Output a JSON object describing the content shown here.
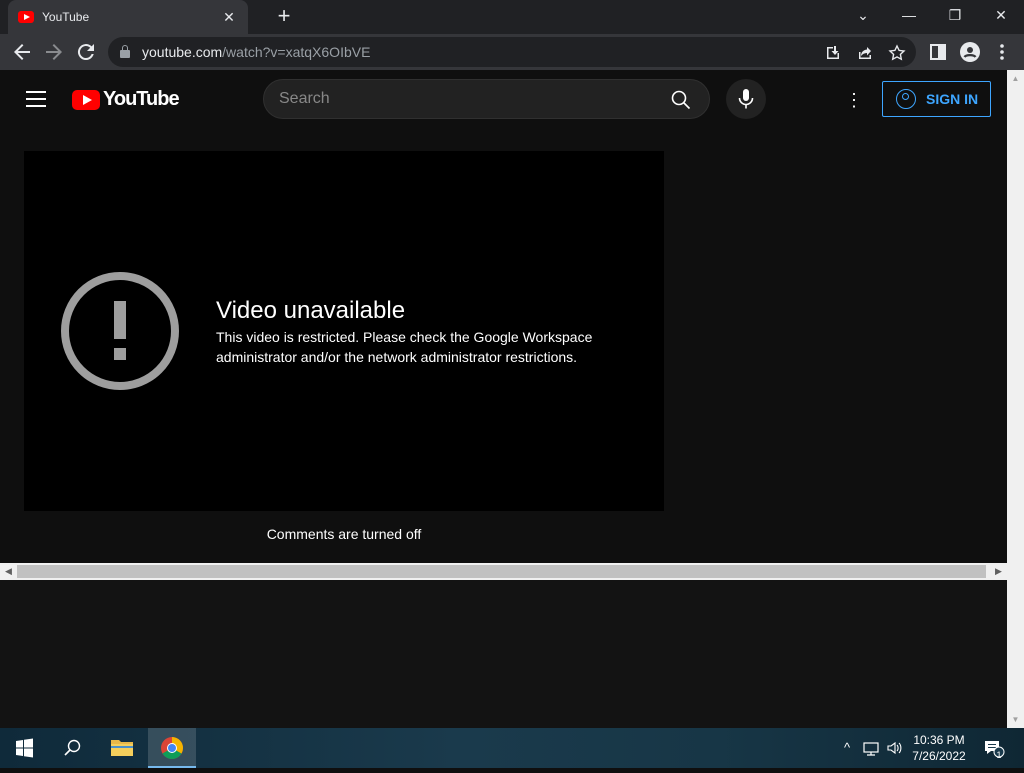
{
  "browser": {
    "tab_title": "YouTube",
    "tab_close": "✕",
    "new_tab": "+",
    "url_host": "youtube.com",
    "url_path": "/watch?v=xatqX6OIbVE",
    "window_controls": {
      "dropdown": "⌄",
      "minimize": "—",
      "restore": "❐",
      "close": "✕"
    }
  },
  "youtube": {
    "logo_text": "YouTube",
    "search_placeholder": "Search",
    "sign_in_label": "SIGN IN",
    "more_label": "⋮",
    "error": {
      "title": "Video unavailable",
      "message": "This video is restricted. Please check the Google Workspace administrator and/or the network administrator restrictions."
    },
    "comments_status": "Comments are turned off"
  },
  "taskbar": {
    "time": "10:36 PM",
    "date": "7/26/2022",
    "notification_count": "1"
  },
  "colors": {
    "accent": "#3ea6ff",
    "youtube_red": "#ff0000",
    "background": "#0f0f0f"
  }
}
